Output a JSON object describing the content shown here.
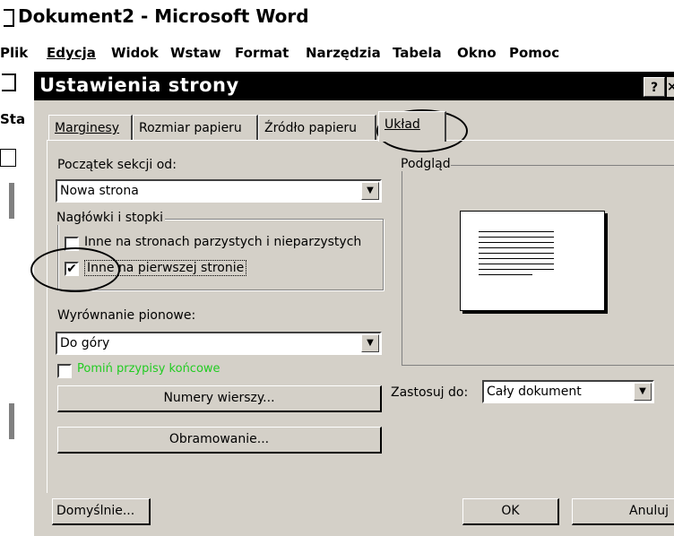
{
  "window": {
    "title": "Dokument2 - Microsoft Word"
  },
  "menu": [
    {
      "label": "Plik"
    },
    {
      "label": "Edycja"
    },
    {
      "label": "Widok"
    },
    {
      "label": "Wstaw"
    },
    {
      "label": "Format"
    },
    {
      "label": "Narzędzia"
    },
    {
      "label": "Tabela"
    },
    {
      "label": "Okno"
    },
    {
      "label": "Pomoc"
    }
  ],
  "left_strip": {
    "label": "Sta"
  },
  "dialog": {
    "title": "Ustawienia strony",
    "help": "?",
    "close": "×",
    "tabs": [
      "Marginesy",
      "Rozmiar papieru",
      "Źródło papieru",
      "Układ"
    ],
    "active_tab": "Układ",
    "section_start_label": "Początek sekcji od:",
    "section_start_value": "Nowa strona",
    "headers_group": "Nagłówki i stopki",
    "odd_even_label": "Inne na stronach parzystych i nieparzystych",
    "odd_even_checked": false,
    "first_page_label": "Inne na pierwszej stronie",
    "first_page_checked": true,
    "vertical_align_label": "Wyrównanie pionowe:",
    "vertical_align_value": "Do góry",
    "suppress_endnotes_label": "Pomiń przypisy końcowe",
    "line_numbers_button": "Numery wierszy...",
    "borders_button": "Obramowanie...",
    "preview_group": "Podgląd",
    "apply_to_label": "Zastosuj do:",
    "apply_to_value": "Cały dokument",
    "default_button": "Domyślnie...",
    "ok_button": "OK",
    "cancel_button": "Anuluj",
    "check_mark": "✔",
    "arrow": "▼"
  }
}
